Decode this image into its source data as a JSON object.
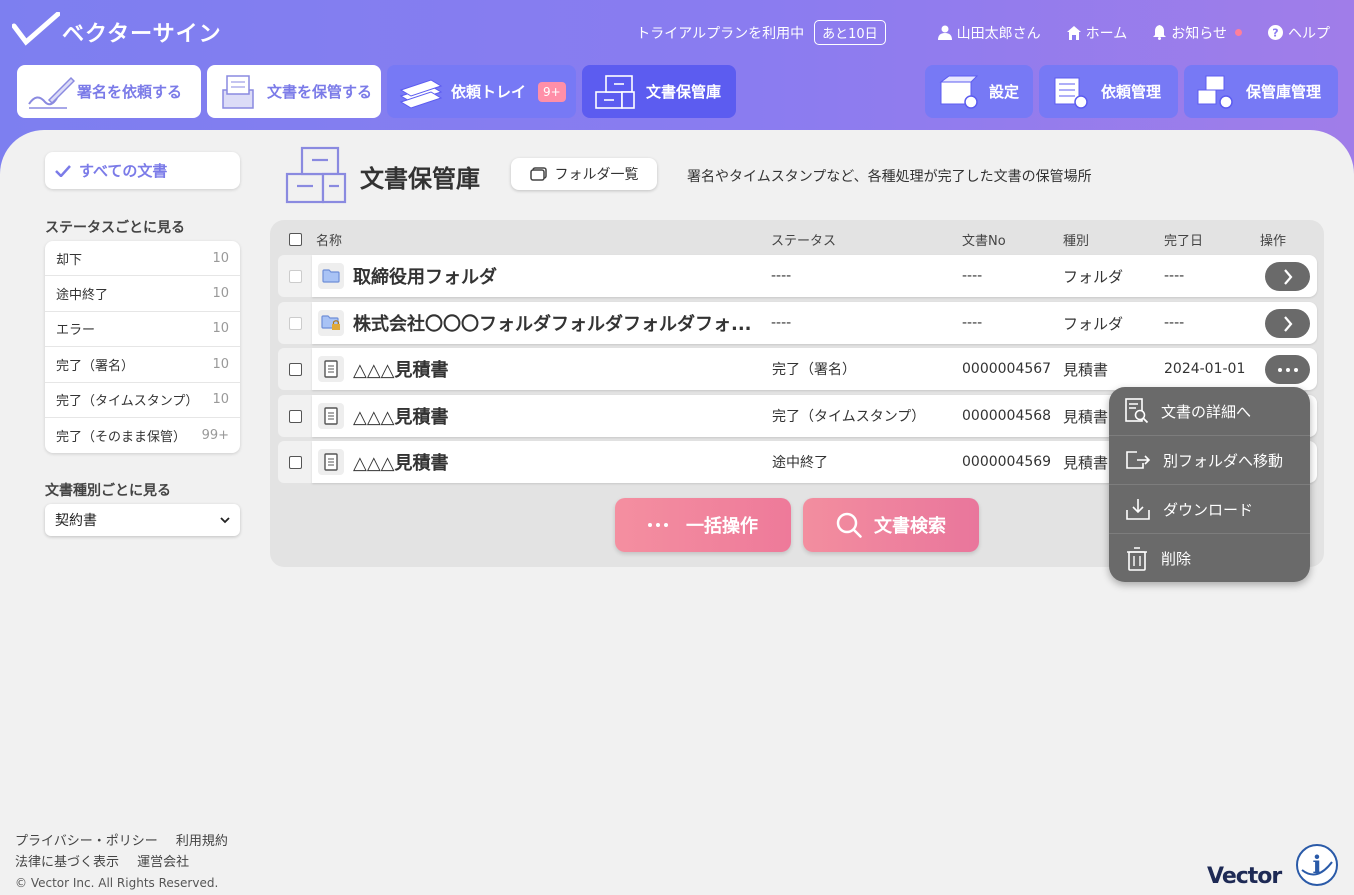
{
  "brand": {
    "name": "ベクターサイン"
  },
  "topbar": {
    "trial": "トライアルプランを利用中",
    "days_left": "あと10日",
    "user": "山田太郎さん",
    "home": "ホーム",
    "notice": "お知らせ",
    "help": "ヘルプ"
  },
  "nav": {
    "request_sign": "署名を依頼する",
    "store_doc": "文書を保管する",
    "request_tray": "依頼トレイ",
    "request_tray_badge": "9+",
    "vault": "文書保管庫",
    "settings": "設定",
    "request_mgmt": "依頼管理",
    "vault_mgmt": "保管庫管理"
  },
  "sidebar": {
    "all_docs": "すべての文書",
    "status_heading": "ステータスごとに見る",
    "statuses": [
      {
        "label": "却下",
        "count": "10"
      },
      {
        "label": "途中終了",
        "count": "10"
      },
      {
        "label": "エラー",
        "count": "10"
      },
      {
        "label": "完了（署名）",
        "count": "10"
      },
      {
        "label": "完了（タイムスタンプ）",
        "count": "10"
      },
      {
        "label": "完了（そのまま保管）",
        "count": "99+"
      }
    ],
    "type_heading": "文書種別ごとに見る",
    "type_selected": "契約書"
  },
  "page": {
    "title": "文書保管庫",
    "folder_list": "フォルダ一覧",
    "description": "署名やタイムスタンプなど、各種処理が完了した文書の保管場所"
  },
  "table": {
    "headers": {
      "name": "名称",
      "status": "ステータス",
      "doc_no": "文書No",
      "type": "種別",
      "completed": "完了日",
      "ops": "操作"
    },
    "rows": [
      {
        "name": "取締役用フォルダ",
        "status": "----",
        "doc_no": "----",
        "type": "フォルダ",
        "completed": "----"
      },
      {
        "name": "株式会社〇〇〇フォルダフォルダフォルダフォ...",
        "status": "----",
        "doc_no": "----",
        "type": "フォルダ",
        "completed": "----"
      },
      {
        "name": "△△△見積書",
        "status": "完了（署名）",
        "doc_no": "0000004567",
        "type": "見積書",
        "completed": "2024-01-01"
      },
      {
        "name": "△△△見積書",
        "status": "完了（タイムスタンプ）",
        "doc_no": "0000004568",
        "type": "見積書",
        "completed": ""
      },
      {
        "name": "△△△見積書",
        "status": "途中終了",
        "doc_no": "0000004569",
        "type": "見積書",
        "completed": ""
      }
    ]
  },
  "actions": {
    "bulk": "一括操作",
    "search": "文書検索"
  },
  "menu": {
    "details": "文書の詳細へ",
    "move": "別フォルダへ移動",
    "download": "ダウンロード",
    "delete": "削除"
  },
  "footer": {
    "privacy": "プライバシー・ポリシー",
    "terms": "利用規約",
    "legal": "法律に基づく表示",
    "company": "運営会社",
    "copyright": "© Vector Inc. All Rights Reserved.",
    "vector_logo": "Vector"
  },
  "colors": {
    "accent": "#7b7be8",
    "nav_active": "#5c5cf0",
    "pink": "#ee7a9a",
    "menu_bg": "#6a6a6a"
  }
}
